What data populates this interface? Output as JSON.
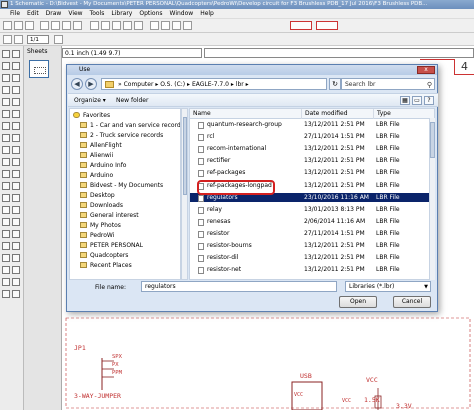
{
  "window": {
    "title": "1 Schematic - D:\\Bidvest - My Documents\\PETER PERSONAL\\Quadcopters\\PedroWi\\Develop circuit for F3 Brushless PDB_17 Jul 2016\\F3 Brushless PDB..."
  },
  "menu": [
    "File",
    "Edit",
    "Draw",
    "View",
    "Tools",
    "Library",
    "Options",
    "Window",
    "Help"
  ],
  "toolbar": {
    "page_select": "1/1"
  },
  "sheets": {
    "label": "Sheets"
  },
  "status": {
    "coordinates": "0.1 inch (1.49 9.7)"
  },
  "canvas": {
    "frame_number": "4",
    "labels": {
      "jp1": "JP1",
      "spx": "SPX",
      "px": "PX",
      "ppm": "PPM",
      "jumper": "3-WAY-JUMPER",
      "usb": "USB",
      "vcc1": "VCC",
      "vcc2": "VCC",
      "vcc3": "VCC",
      "r1": "1.5K",
      "v33": "3.3V"
    }
  },
  "dialog": {
    "title": "Use",
    "close": "x",
    "nav": {
      "back": "◀",
      "forward": "▶"
    },
    "address": "» Computer ▸ O.S. (C:) ▸ EAGLE-7.7.0 ▸ lbr ▸",
    "refresh": "↻",
    "search_placeholder": "Search lbr",
    "organize": "Organize ▾",
    "new_folder": "New folder",
    "help": "?",
    "nav_items": [
      {
        "label": "Favorites",
        "star": true
      },
      {
        "label": "1 - Car and van service records"
      },
      {
        "label": "2 - Truck service records"
      },
      {
        "label": "AllenFlight"
      },
      {
        "label": "Alienwii"
      },
      {
        "label": "Arduino Info"
      },
      {
        "label": "Arduino"
      },
      {
        "label": "Bidvest - My Documents"
      },
      {
        "label": "Desktop"
      },
      {
        "label": "Downloads"
      },
      {
        "label": "General interest"
      },
      {
        "label": "My Photos"
      },
      {
        "label": "PedroWi"
      },
      {
        "label": "PETER PERSONAL"
      },
      {
        "label": "Quadcopters"
      },
      {
        "label": "Recent Places"
      }
    ],
    "columns": [
      "Name",
      "Date modified",
      "Type"
    ],
    "files": [
      {
        "name": "quantum-research-group",
        "date": "13/12/2011 2:51 PM",
        "type": "LBR File"
      },
      {
        "name": "rcl",
        "date": "27/11/2014 1:51 PM",
        "type": "LBR File"
      },
      {
        "name": "recom-international",
        "date": "13/12/2011 2:51 PM",
        "type": "LBR File"
      },
      {
        "name": "rectifier",
        "date": "13/12/2011 2:51 PM",
        "type": "LBR File"
      },
      {
        "name": "ref-packages",
        "date": "13/12/2011 2:51 PM",
        "type": "LBR File"
      },
      {
        "name": "ref-packages-longpad",
        "date": "13/12/2011 2:51 PM",
        "type": "LBR File"
      },
      {
        "name": "regulators",
        "date": "23/10/2016 11:16 AM",
        "type": "LBR File",
        "selected": true
      },
      {
        "name": "relay",
        "date": "13/01/2013 8:13 PM",
        "type": "LBR File"
      },
      {
        "name": "renesas",
        "date": "2/06/2014 11:16 AM",
        "type": "LBR File"
      },
      {
        "name": "resistor",
        "date": "27/11/2014 1:51 PM",
        "type": "LBR File"
      },
      {
        "name": "resistor-bourns",
        "date": "13/12/2011 2:51 PM",
        "type": "LBR File"
      },
      {
        "name": "resistor-dil",
        "date": "13/12/2011 2:51 PM",
        "type": "LBR File"
      },
      {
        "name": "resistor-net",
        "date": "13/12/2011 2:51 PM",
        "type": "LBR File"
      }
    ],
    "file_name_label": "File name:",
    "file_name_value": "regulators",
    "filter_value": "Libraries (*.lbr)",
    "open_label": "Open",
    "cancel_label": "Cancel"
  },
  "colors": {
    "selection": "#0a246a",
    "highlight_ring": "#d32020",
    "schematic": "#c03030",
    "dialog_bg": "#dbe6f4"
  }
}
